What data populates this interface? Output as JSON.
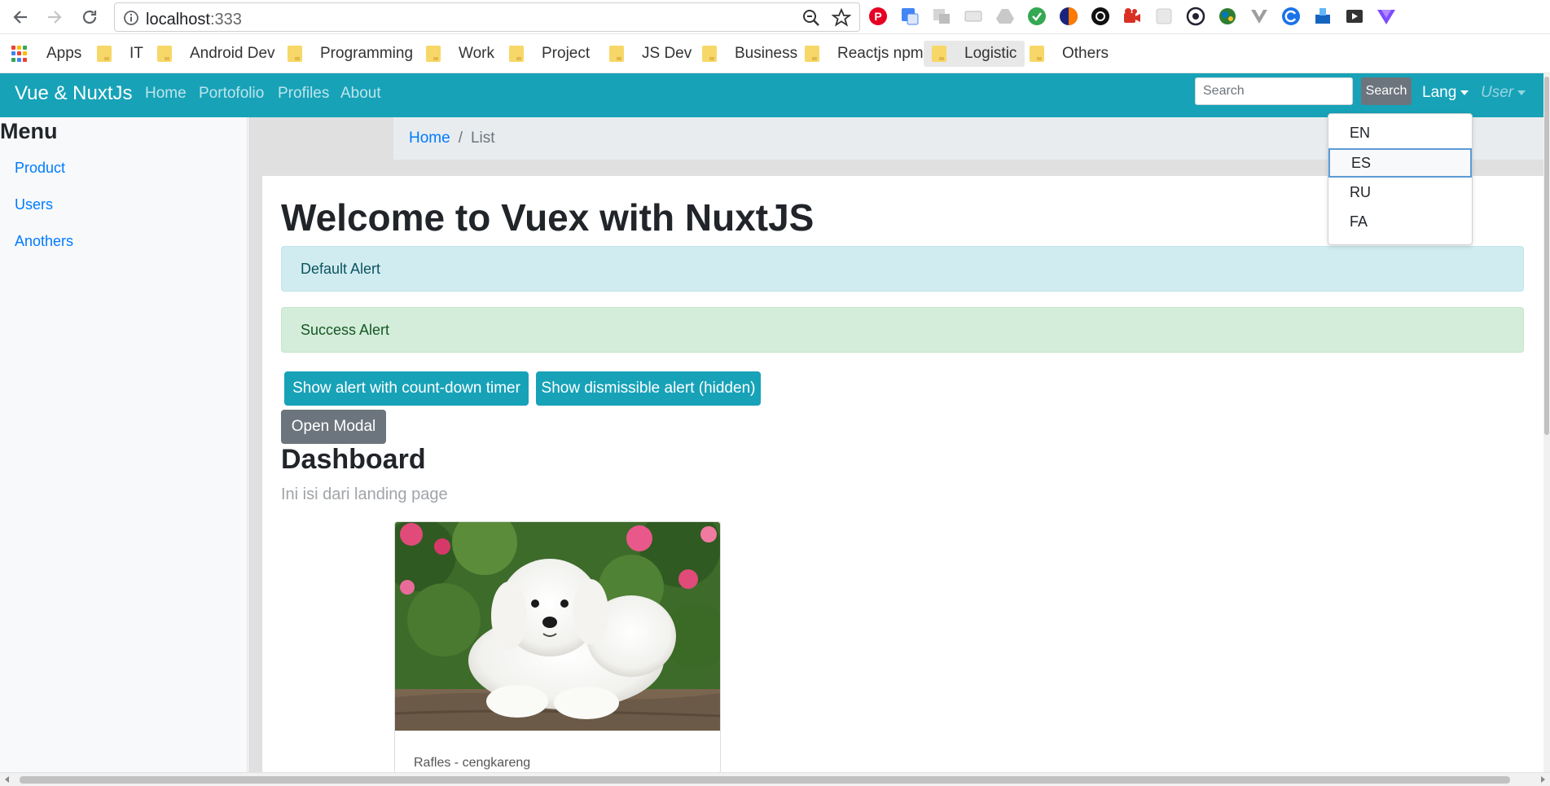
{
  "browser": {
    "url_host": "localhost",
    "url_port": ":333",
    "bookmarks": [
      {
        "label": "Apps"
      },
      {
        "label": "IT"
      },
      {
        "label": "Android Dev"
      },
      {
        "label": "Programming"
      },
      {
        "label": "Work"
      },
      {
        "label": "Project"
      },
      {
        "label": "JS Dev"
      },
      {
        "label": "Business"
      },
      {
        "label": "Reactjs npm"
      },
      {
        "label": "Logistic"
      },
      {
        "label": "Others"
      }
    ],
    "extension_icons": [
      "pinterest-icon",
      "google-translate-icon",
      "image-translate-icon",
      "screenshot-icon",
      "drive-icon",
      "vpn-icon",
      "sync-icon",
      "link-icon",
      "video-icon",
      "puzzle-icon",
      "camera-icon",
      "globe-icon",
      "vue-devtools-icon",
      "refresh-extension-icon",
      "upload-icon",
      "media-icon",
      "vue-icon"
    ]
  },
  "navbar": {
    "brand": "Vue & NuxtJs",
    "links": [
      "Home",
      "Portofolio",
      "Profiles",
      "About"
    ],
    "search_placeholder": "Search",
    "search_button": "Search",
    "lang_label": "Lang",
    "user_label": "User"
  },
  "lang_menu": {
    "items": [
      "EN",
      "ES",
      "RU",
      "FA"
    ],
    "focused": "ES"
  },
  "sidebar": {
    "title": "Menu",
    "items": [
      "Product",
      "Users",
      "Anothers"
    ]
  },
  "breadcrumb": {
    "home": "Home",
    "separator": "/",
    "current": "List"
  },
  "main": {
    "title": "Welcome to Vuex with NuxtJS",
    "alerts": {
      "default": "Default Alert",
      "success": "Success Alert"
    },
    "buttons": {
      "countdown": "Show alert with count-down timer",
      "dismissible": "Show dismissible alert (hidden)",
      "modal": "Open Modal"
    },
    "dashboard_title": "Dashboard",
    "dashboard_lead": "Ini isi dari landing page",
    "card": {
      "text": "Rafles - cengkareng"
    }
  },
  "colors": {
    "primary_navbar": "#17a2b8",
    "link": "#007bff",
    "alert_info_bg": "#d1ecf1",
    "alert_success_bg": "#d4edda",
    "secondary": "#6c757d"
  }
}
